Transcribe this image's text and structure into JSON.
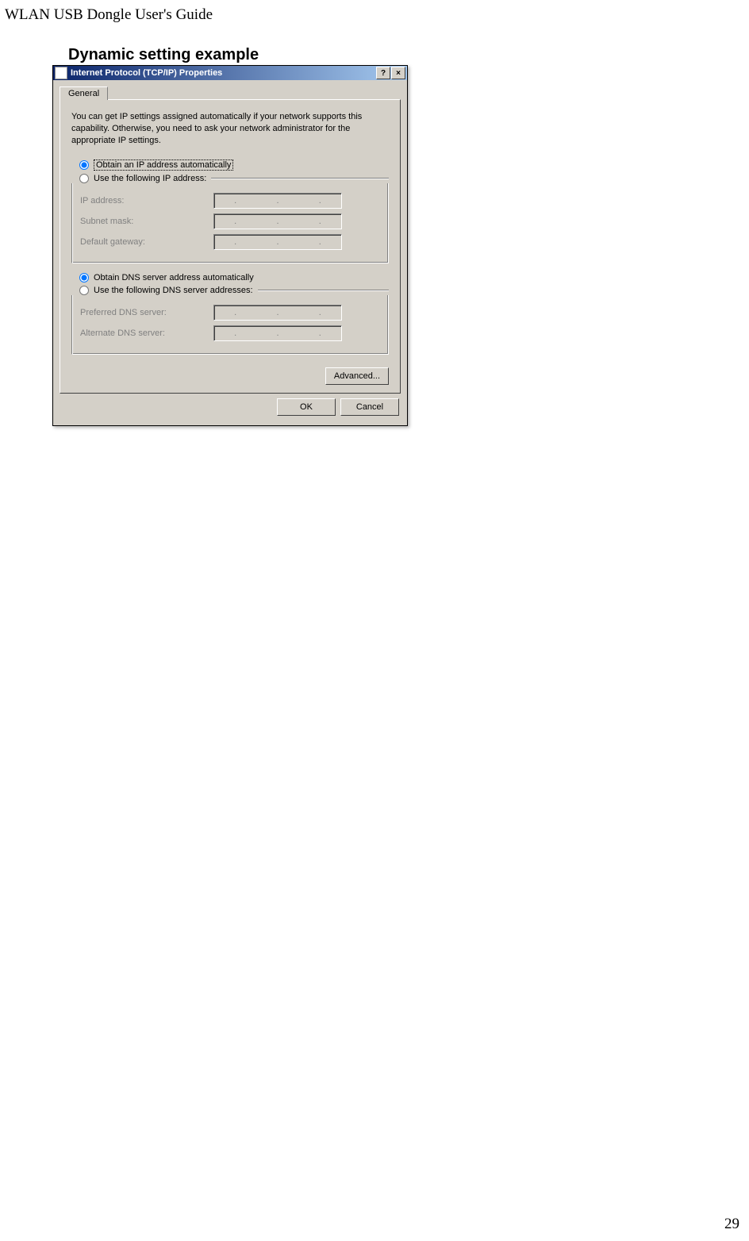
{
  "document": {
    "header": "WLAN USB Dongle User's Guide",
    "section_heading": "Dynamic setting example",
    "page_number": "29"
  },
  "dialog": {
    "title": "Internet Protocol (TCP/IP) Properties",
    "help_btn": "?",
    "close_btn": "×",
    "tab_general": "General",
    "intro": "You can get IP settings assigned automatically if your network supports this capability. Otherwise, you need to ask your network administrator for the appropriate IP settings.",
    "radio_auto_ip": "Obtain an IP address automatically",
    "radio_manual_ip": "Use the following IP address:",
    "label_ip": "IP address:",
    "label_subnet": "Subnet mask:",
    "label_gateway": "Default gateway:",
    "radio_auto_dns": "Obtain DNS server address automatically",
    "radio_manual_dns": "Use the following DNS server addresses:",
    "label_preferred_dns": "Preferred DNS server:",
    "label_alternate_dns": "Alternate DNS server:",
    "btn_advanced": "Advanced...",
    "btn_ok": "OK",
    "btn_cancel": "Cancel"
  }
}
